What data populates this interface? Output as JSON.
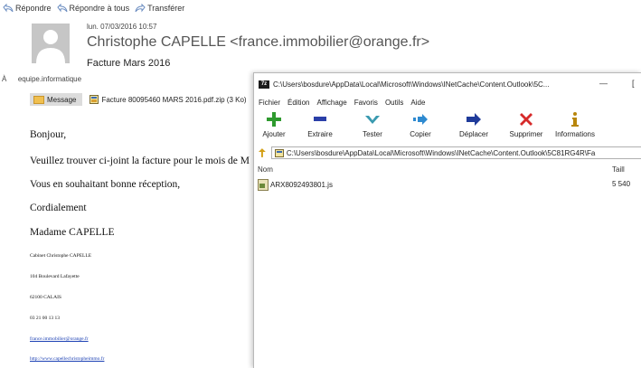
{
  "outlook": {
    "actions": {
      "reply": "Répondre",
      "reply_all": "Répondre à tous",
      "forward": "Transférer"
    },
    "date": "lun. 07/03/2016 10:57",
    "sender": "Christophe CAPELLE <france.immobilier@orange.fr>",
    "subject": "Facture Mars 2016",
    "to_prefix": "À",
    "to": "equipe.informatique",
    "message_tab": "Message",
    "attachment": "Facture 80095460 MARS 2016.pdf.zip (3 Ko)"
  },
  "email_body": {
    "greeting": "Bonjour,",
    "line1": "Veuillez trouver ci-joint la facture pour le mois de M",
    "line2": "Vous en souhaitant bonne réception,",
    "line3": "Cordialement",
    "signature_name": "Madame CAPELLE",
    "company": "Cabinet Christophe CAPELLE",
    "address1": "104 Boulevard Lafayette",
    "address2": "62100 CALAIS",
    "phone": "03 21 00 13 13",
    "email_link": "france.immobilier@orange.fr",
    "website_link": "http://www.capellechristopheimmo.fr"
  },
  "zip_window": {
    "logo": "7z",
    "title": "C:\\Users\\bosdure\\AppData\\Local\\Microsoft\\Windows\\INetCache\\Content.Outlook\\5C...",
    "minimize": "—",
    "restore": "[",
    "menu": [
      "Fichier",
      "Édition",
      "Affichage",
      "Favoris",
      "Outils",
      "Aide"
    ],
    "toolbar": [
      {
        "label": "Ajouter",
        "icon": "plus-icon",
        "color": "#2e9a2e"
      },
      {
        "label": "Extraire",
        "icon": "minus-icon",
        "color": "#2a3fa8"
      },
      {
        "label": "Tester",
        "icon": "check-icon",
        "color": "#3a9ab0"
      },
      {
        "label": "Copier",
        "icon": "copy-arrow-icon",
        "color": "#2e8ad0"
      },
      {
        "label": "Déplacer",
        "icon": "move-arrow-icon",
        "color": "#1f3b9a"
      },
      {
        "label": "Supprimer",
        "icon": "delete-x-icon",
        "color": "#d62a2a"
      },
      {
        "label": "Informations",
        "icon": "info-icon",
        "color": "#b8860b"
      }
    ],
    "address": "C:\\Users\\bosdure\\AppData\\Local\\Microsoft\\Windows\\INetCache\\Content.Outlook\\5C81RG4R\\Fa",
    "columns": {
      "name": "Nom",
      "size": "Taill"
    },
    "files": [
      {
        "name": "ARX8092493801.js",
        "size": "5 540"
      }
    ]
  }
}
